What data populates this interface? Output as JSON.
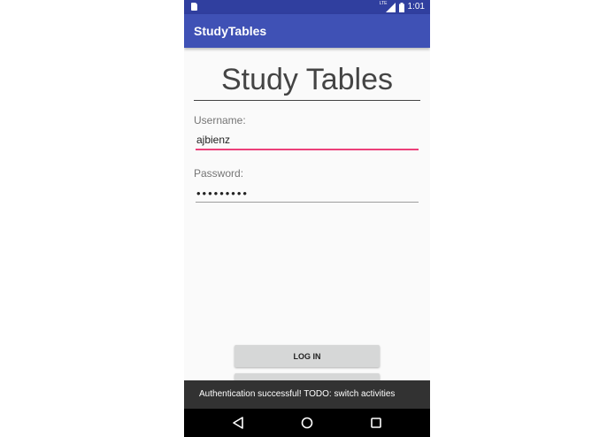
{
  "status_bar": {
    "network_label": "LTE",
    "time": "1:01"
  },
  "app_bar": {
    "title": "StudyTables"
  },
  "login_form": {
    "heading": "Study Tables",
    "username_label": "Username:",
    "username_value": "ajbienz",
    "password_label": "Password:",
    "password_value": "•••••••••",
    "login_button_label": "LOG IN"
  },
  "snackbar": {
    "message": "Authentication successful! TODO: switch activities"
  },
  "icons": {
    "status": [
      "sim-card-icon",
      "signal-icon",
      "battery-icon"
    ],
    "navigation": [
      "back-icon",
      "home-icon",
      "recent-apps-icon"
    ]
  },
  "colors": {
    "primary": "#3f51b5",
    "primary_dark": "#303f9f",
    "accent": "#ec407a",
    "background": "#fafafa",
    "snackbar": "#323232"
  }
}
